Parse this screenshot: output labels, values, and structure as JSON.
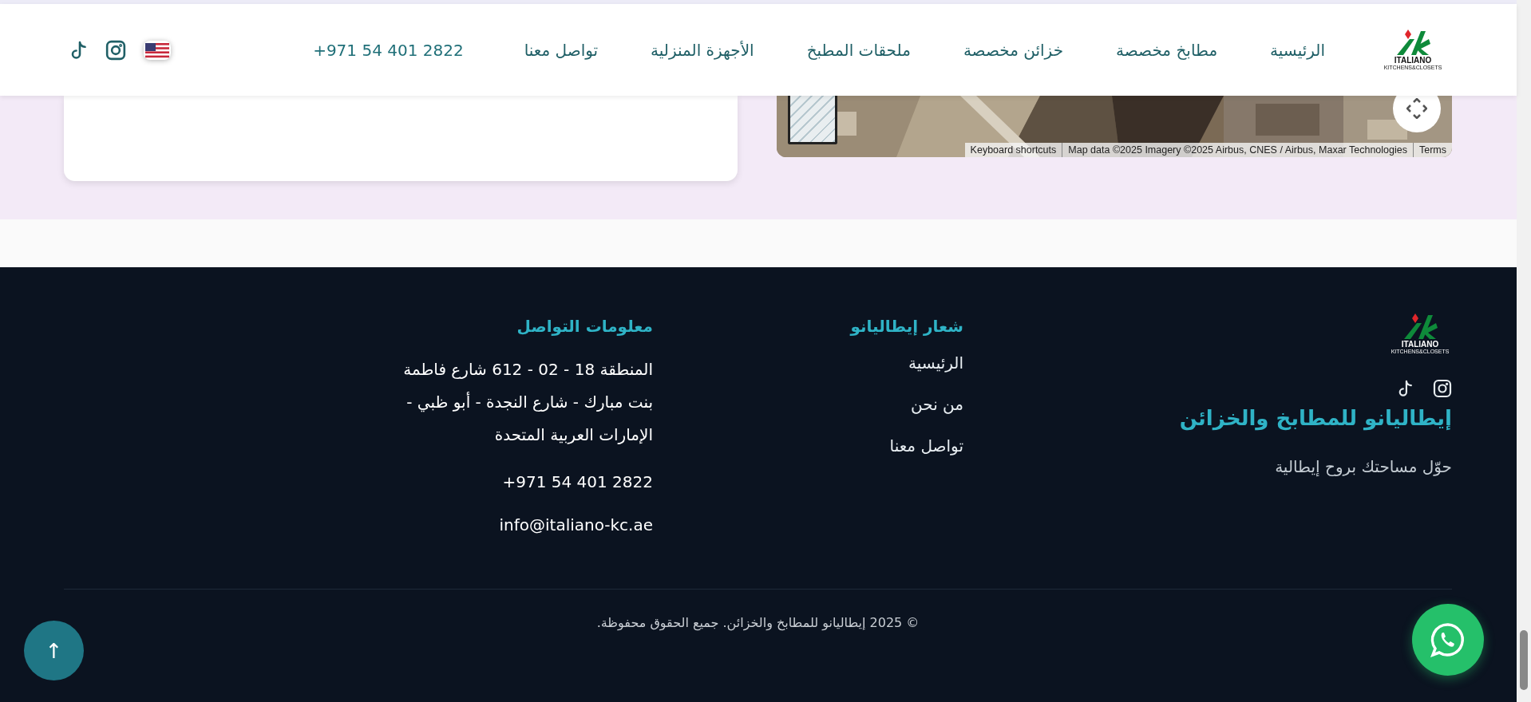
{
  "header": {
    "logo": {
      "name": "ITALIANO",
      "subtitle": "KITCHENS&CLOSETS"
    },
    "nav": [
      {
        "label": "الرئيسية"
      },
      {
        "label": "مطابخ مخصصة"
      },
      {
        "label": "خزائن مخصصة"
      },
      {
        "label": "ملحقات المطبخ"
      },
      {
        "label": "الأجهزة المنزلية"
      },
      {
        "label": "تواصل معنا"
      }
    ],
    "phone": "+971 54 401 2822"
  },
  "map": {
    "attribution": [
      "Terms",
      "Map data ©2025 Imagery ©2025 Airbus, CNES / Airbus, Maxar Technologies",
      "Keyboard shortcuts"
    ]
  },
  "footer": {
    "brand": {
      "logo": {
        "name": "ITALIANO",
        "subtitle": "KITCHENS&CLOSETS"
      },
      "title": "إيطاليانو للمطابخ والخزائن",
      "tagline": "حوّل مساحتك بروح إيطالية"
    },
    "links": {
      "heading": "شعار إيطاليانو",
      "items": [
        "الرئيسية",
        "من نحن",
        "تواصل معنا"
      ]
    },
    "contact": {
      "heading": "معلومات التواصل",
      "address_lines": [
        "المنطقة 18 - 02 - 612 شارع فاطمة",
        "بنت مبارك - شارع النجدة - أبو ظبي -",
        "الإمارات العربية المتحدة"
      ],
      "phone": "+971 54 401 2822",
      "email": "info@italiano-kc.ae"
    },
    "copyright": "© 2025 إيطاليانو للمطابخ والخزائن. جميع الحقوق محفوظة."
  },
  "back_to_top": "↑"
}
